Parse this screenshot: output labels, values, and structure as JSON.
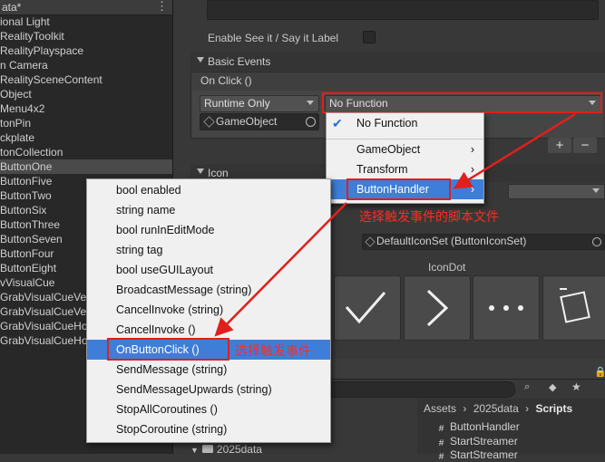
{
  "hierarchy": {
    "title": "ata*",
    "rows": [
      "ional Light",
      "RealityToolkit",
      "RealityPlayspace",
      "n Camera",
      "RealitySceneContent",
      "Object",
      "Menu4x2",
      "tonPin",
      "ckplate",
      "tonCollection",
      "ButtonOne",
      "ButtonFive",
      "ButtonTwo",
      "ButtonSix",
      "ButtonThree",
      "ButtonSeven",
      "ButtonFour",
      "ButtonEight",
      "vVisualCue",
      "GrabVisualCueVe",
      "GrabVisualCueVe",
      "GrabVisualCueHo",
      "GrabVisualCueHo"
    ]
  },
  "inspector": {
    "enable_see_it_label": "Enable See it / Say it Label",
    "basic_events_label": "Basic Events",
    "on_click_label": "On Click ()",
    "runtime_dropdown": "Runtime Only",
    "function_dropdown": "No Function",
    "object_field": "GameObject",
    "plus_label": "+",
    "minus_label": "−",
    "icon_section_label": "Icon",
    "icon_set_field": "DefaultIconSet (ButtonIconSet)",
    "icon_dot_label": "IconDot"
  },
  "function_menu": {
    "items": [
      {
        "label": "No Function",
        "checked": true
      },
      {
        "label": "GameObject",
        "submenu": true
      },
      {
        "label": "Transform",
        "submenu": true
      },
      {
        "label": "ButtonHandler",
        "submenu": true,
        "highlighted": true
      }
    ]
  },
  "method_menu": {
    "items": [
      "bool enabled",
      "string name",
      "bool runInEditMode",
      "string tag",
      "bool useGUILayout",
      "BroadcastMessage (string)",
      "CancelInvoke (string)",
      "CancelInvoke ()",
      "OnButtonClick ()",
      "SendMessage (string)",
      "SendMessageUpwards (string)",
      "StopAllCoroutines ()",
      "StopCoroutine (string)"
    ],
    "highlighted_index": 8
  },
  "annotations": {
    "script_note": "选择触发事件的脚本文件",
    "event_note": "选择触发事件",
    "color": "#e0201c"
  },
  "project": {
    "breadcrumb": [
      "Assets",
      "2025data",
      "Scripts"
    ],
    "folder_label": "2025data",
    "files": [
      "ButtonHandler",
      "StartStreamer",
      "StartStreamer"
    ]
  },
  "colors": {
    "selection_blue": "#3e7ed8",
    "menu_bg": "#f0f0f0",
    "annotation_red": "#e0201c"
  }
}
